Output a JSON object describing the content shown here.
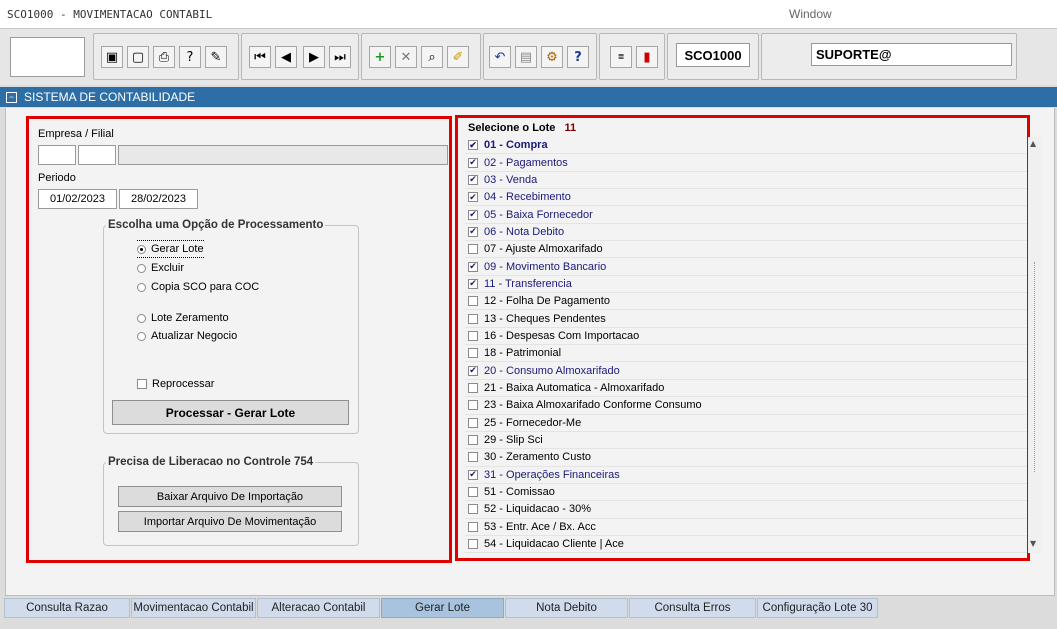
{
  "window": {
    "title": "SCO1000 - MOVIMENTACAO CONTABIL",
    "menu": "Window"
  },
  "toolbar": {
    "form_code": "SCO1000",
    "user": "SUPORTE@"
  },
  "header": {
    "title": "SISTEMA DE CONTABILIDADE"
  },
  "left": {
    "empresa_label": "Empresa / Filial",
    "empresa_code": "",
    "filial_code": "",
    "empresa_name": "",
    "periodo_label": "Periodo",
    "date_from": "01/02/2023",
    "date_to": "28/02/2023",
    "options_title": "Escolha uma Opção de Processamento",
    "options": [
      {
        "label": "Gerar Lote",
        "selected": true
      },
      {
        "label": "Excluir",
        "selected": false
      },
      {
        "label": "Copia SCO para COC",
        "selected": false
      },
      {
        "label": "Lote Zeramento",
        "selected": false
      },
      {
        "label": "Atualizar Negocio",
        "selected": false
      }
    ],
    "reprocessar_label": "Reprocessar",
    "process_button": "Processar - Gerar Lote",
    "liberacao_title": "Precisa de Liberacao no Controle 754",
    "baixar_button": "Baixar Arquivo De Importação",
    "importar_button": "Importar Arquivo De Movimentação"
  },
  "right": {
    "title": "Selecione o Lote",
    "count": "11",
    "items": [
      {
        "label": "01 - Compra",
        "checked": true
      },
      {
        "label": "02 - Pagamentos",
        "checked": true
      },
      {
        "label": "03 - Venda",
        "checked": true
      },
      {
        "label": "04 - Recebimento",
        "checked": true
      },
      {
        "label": "05 - Baixa Fornecedor",
        "checked": true
      },
      {
        "label": "06 - Nota Debito",
        "checked": true
      },
      {
        "label": "07 - Ajuste Almoxarifado",
        "checked": false
      },
      {
        "label": "09 - Movimento Bancario",
        "checked": true
      },
      {
        "label": "11 - Transferencia",
        "checked": true
      },
      {
        "label": "12 - Folha De Pagamento",
        "checked": false
      },
      {
        "label": "13 - Cheques Pendentes",
        "checked": false
      },
      {
        "label": "16 - Despesas Com Importacao",
        "checked": false
      },
      {
        "label": "18 - Patrimonial",
        "checked": false
      },
      {
        "label": "20 - Consumo Almoxarifado",
        "checked": true
      },
      {
        "label": "21 - Baixa Automatica - Almoxarifado",
        "checked": false
      },
      {
        "label": "23 - Baixa Almoxarifado Conforme Consumo",
        "checked": false
      },
      {
        "label": "25 - Fornecedor-Me",
        "checked": false
      },
      {
        "label": "29 - Slip Sci",
        "checked": false
      },
      {
        "label": "30 - Zeramento Custo",
        "checked": false
      },
      {
        "label": "31 - Operações Financeiras",
        "checked": true
      },
      {
        "label": "51 - Comissao",
        "checked": false
      },
      {
        "label": "52 - Liquidacao - 30%",
        "checked": false
      },
      {
        "label": "53 - Entr. Ace / Bx. Acc",
        "checked": false
      },
      {
        "label": "54 - Liquidacao Cliente | Ace",
        "checked": false
      }
    ]
  },
  "tabs": [
    {
      "label": "Consulta Razao",
      "active": false
    },
    {
      "label": "Movimentacao Contabil",
      "active": false
    },
    {
      "label": "Alteracao Contabil",
      "active": false
    },
    {
      "label": "Gerar Lote",
      "active": true
    },
    {
      "label": "Nota Debito",
      "active": false
    },
    {
      "label": "Consulta Erros",
      "active": false
    },
    {
      "label": "Configuração Lote 30",
      "active": false
    }
  ],
  "icons": [
    "save-icon",
    "print-preview-icon",
    "print-icon",
    "help-query-icon",
    "edit-icon",
    "first-record-icon",
    "previous-record-icon",
    "next-record-icon",
    "last-record-icon",
    "insert-record-icon",
    "delete-record-icon",
    "query-icon",
    "clear-icon",
    "undo-icon",
    "clipboard-icon",
    "tools-icon",
    "help-icon",
    "menu-icon",
    "exit-icon"
  ],
  "colors": {
    "header": "#2e6ea6",
    "highlight_border": "#e00000",
    "selected_text": "#1a1a7a",
    "active_tab": "#a7c3de"
  }
}
